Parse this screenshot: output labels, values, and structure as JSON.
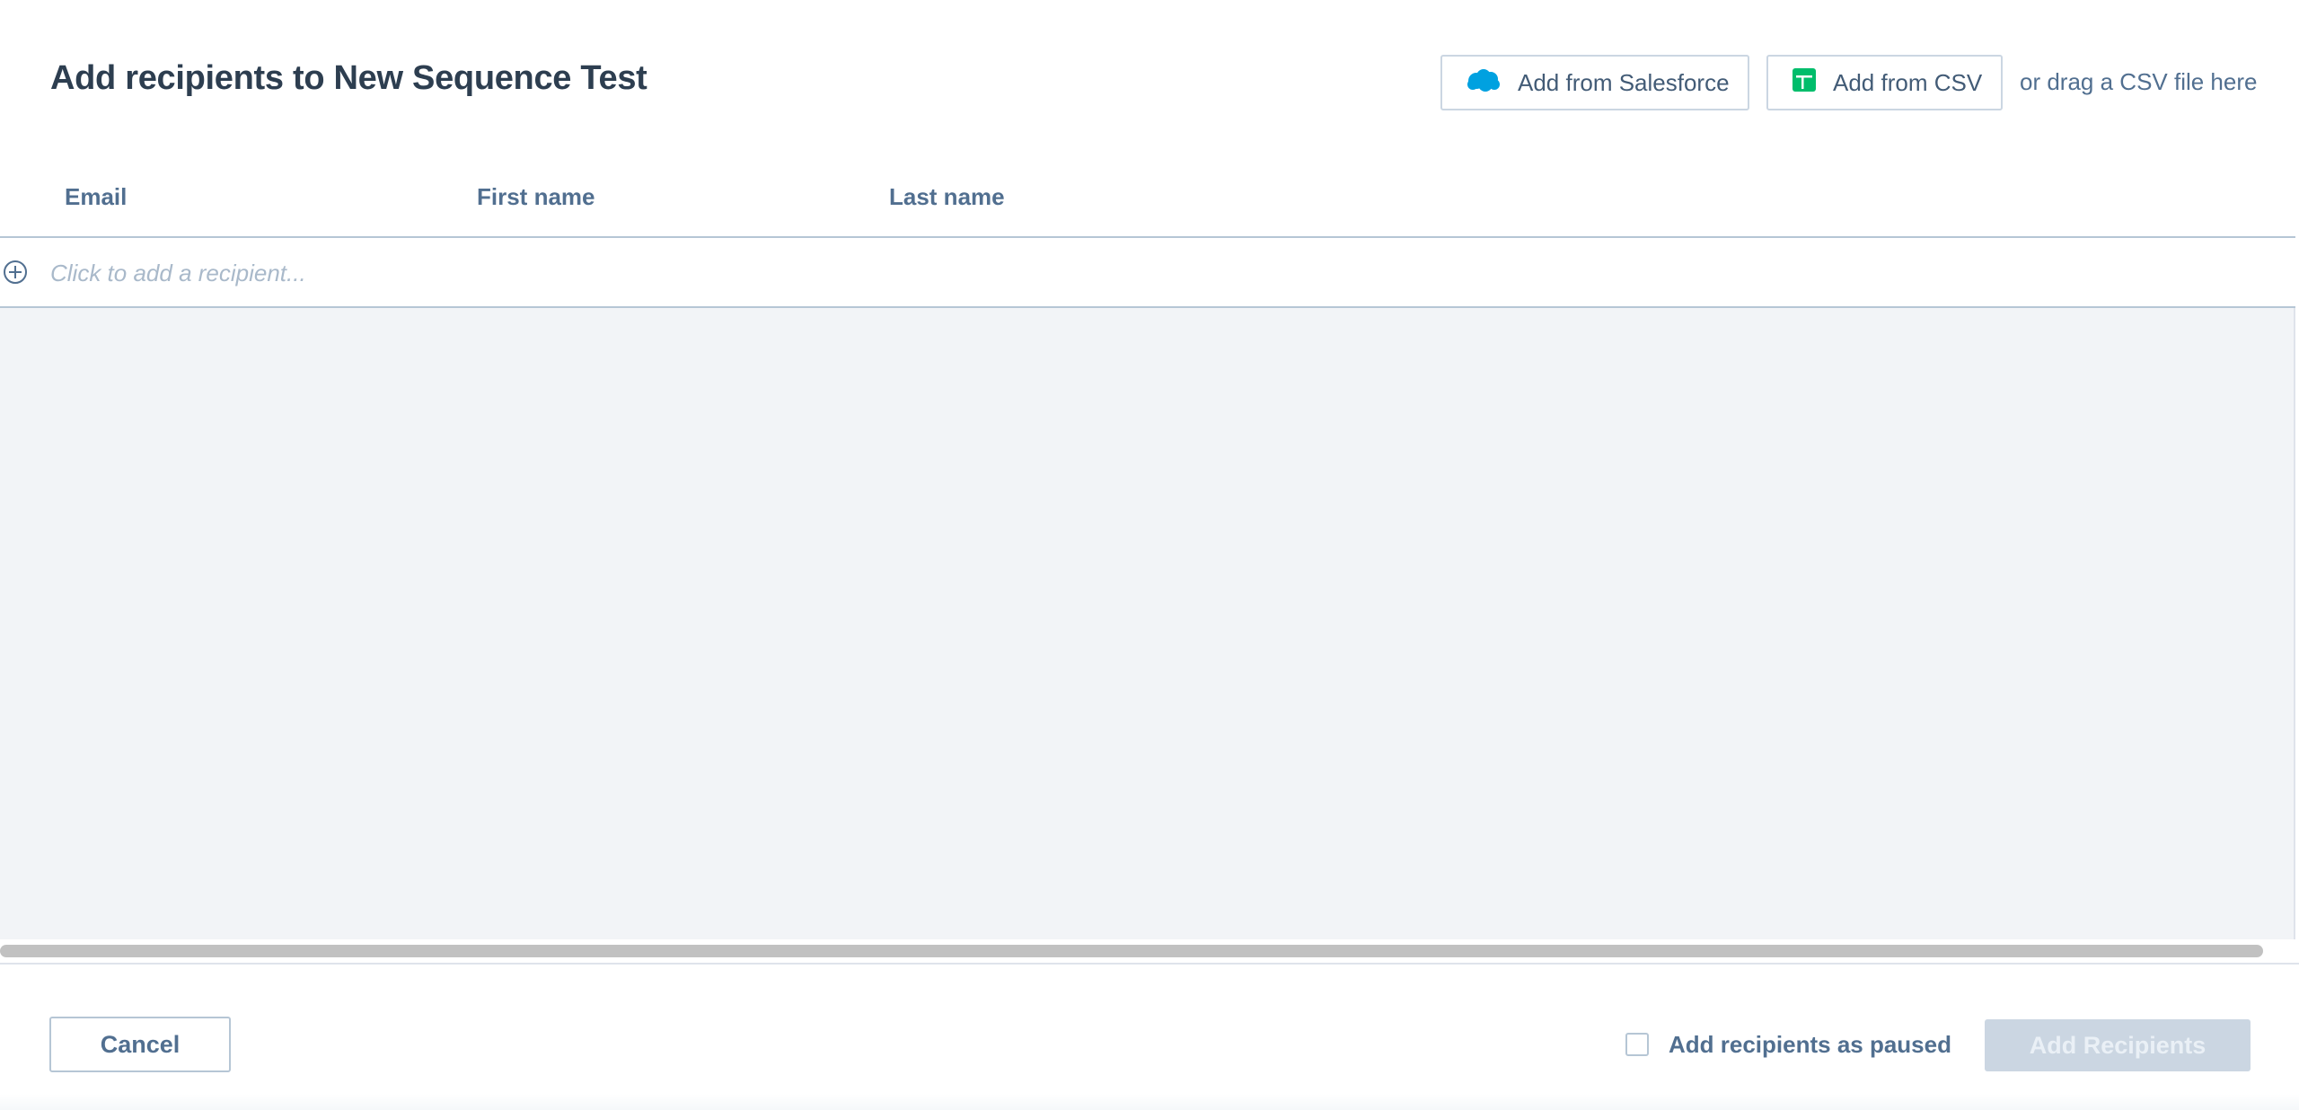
{
  "header": {
    "title_prefix": "Add recipients to ",
    "sequence_name": "New Sequence Test",
    "salesforce_button": {
      "label": "Add from Salesforce",
      "icon": "salesforce-cloud-icon",
      "icon_color": "#00a1e0"
    },
    "csv_button": {
      "label": "Add from CSV",
      "icon": "spreadsheet-icon",
      "icon_color": "#00bd6b"
    },
    "drag_hint": "or drag a CSV file here"
  },
  "table": {
    "columns": [
      "Email",
      "First name",
      "Last name"
    ],
    "add_row_placeholder": "Click to add a recipient...",
    "add_icon": "plus-circle-icon"
  },
  "footer": {
    "cancel_label": "Cancel",
    "paused_label": "Add recipients as paused",
    "paused_checked": false,
    "add_button_label": "Add Recipients",
    "add_button_disabled": true
  },
  "colors": {
    "text_primary": "#2d3e50",
    "text_secondary": "#516f90",
    "border": "#cbd6e2",
    "table_background": "#f2f4f7",
    "disabled_button": "#cbd6e2"
  }
}
